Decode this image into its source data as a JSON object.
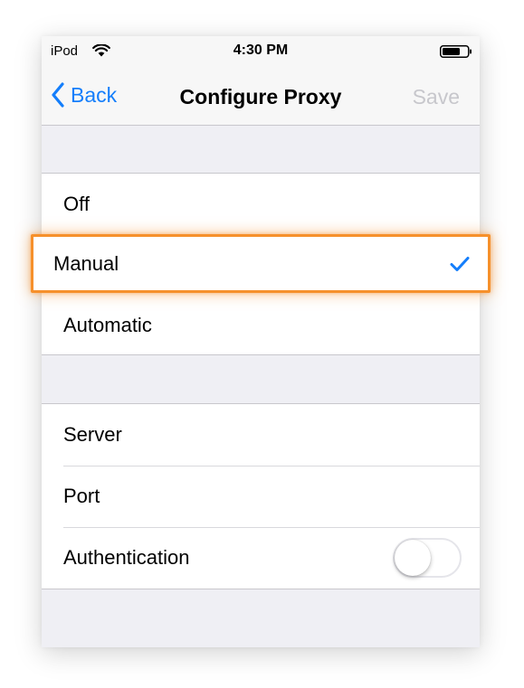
{
  "status_bar": {
    "carrier": "iPod",
    "time": "4:30 PM"
  },
  "nav": {
    "back_label": "Back",
    "title": "Configure Proxy",
    "save_label": "Save"
  },
  "proxy_modes": {
    "items": [
      {
        "label": "Off"
      },
      {
        "label": "Manual",
        "selected": true
      },
      {
        "label": "Automatic"
      }
    ]
  },
  "settings": {
    "server_label": "Server",
    "port_label": "Port",
    "authentication_label": "Authentication",
    "authentication_enabled": false
  },
  "colors": {
    "accent": "#147efb",
    "highlight": "#f6902b",
    "disabled": "#c7c7cc",
    "background": "#efeff4"
  }
}
